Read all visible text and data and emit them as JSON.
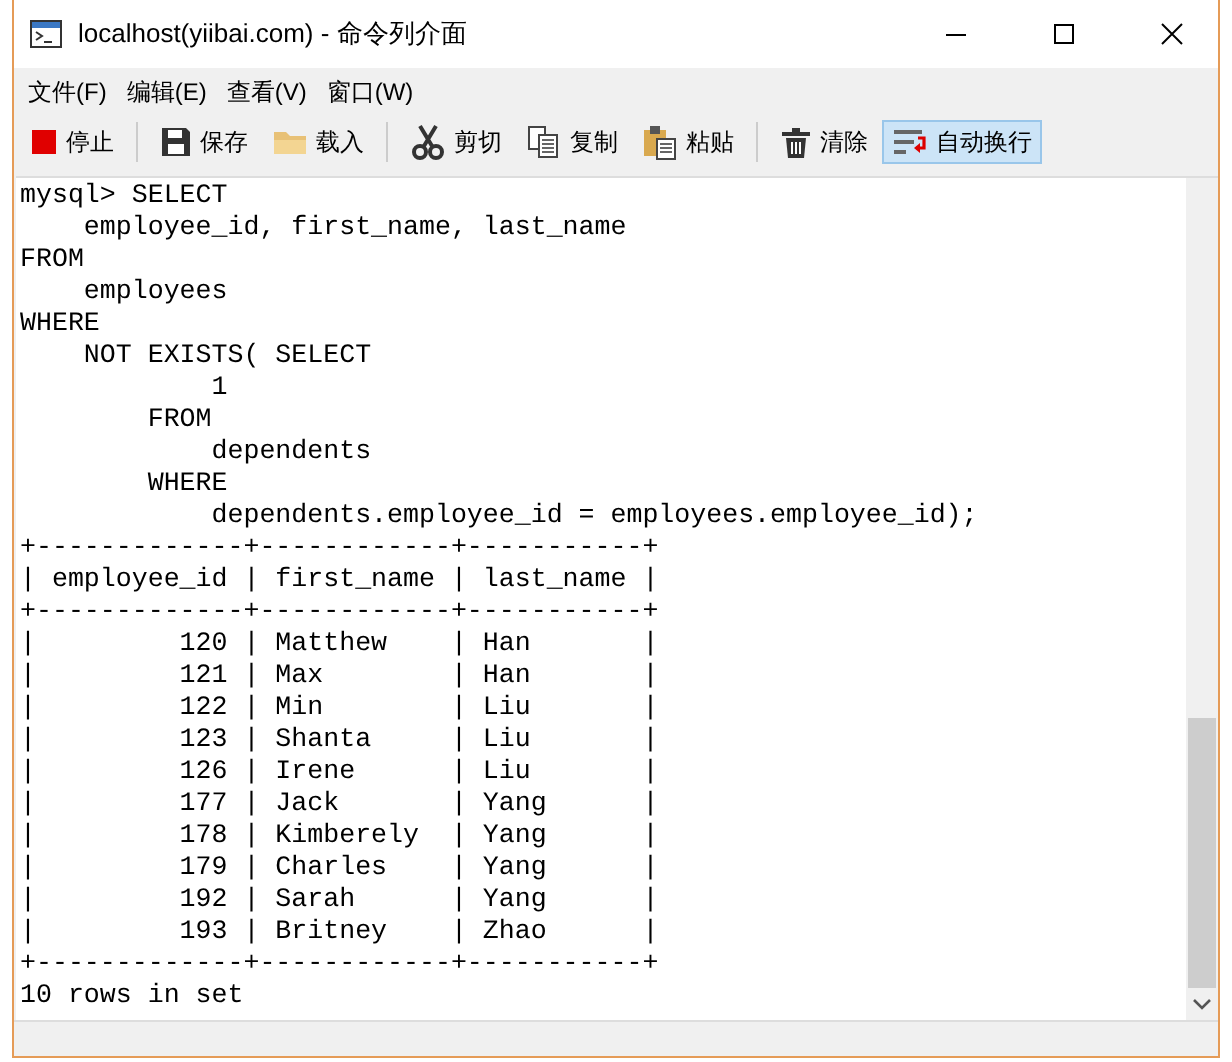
{
  "window": {
    "title": "localhost(yiibai.com) - 命令列介面"
  },
  "menu": [
    "文件(F)",
    "编辑(E)",
    "查看(V)",
    "窗口(W)"
  ],
  "toolbar": [
    {
      "kind": "stop",
      "label": "停止",
      "on": false
    },
    {
      "kind": "save",
      "label": "保存",
      "on": false
    },
    {
      "kind": "load",
      "label": "载入",
      "on": false
    },
    {
      "kind": "cut",
      "label": "剪切",
      "on": false
    },
    {
      "kind": "copy",
      "label": "复制",
      "on": false
    },
    {
      "kind": "paste",
      "label": "粘贴",
      "on": false
    },
    {
      "kind": "clear",
      "label": "清除",
      "on": false
    },
    {
      "kind": "wrap",
      "label": "自动换行",
      "on": true
    }
  ],
  "console": {
    "lines": [
      "mysql> SELECT",
      "    employee_id, first_name, last_name",
      "FROM",
      "    employees",
      "WHERE",
      "    NOT EXISTS( SELECT",
      "            1",
      "        FROM",
      "            dependents",
      "        WHERE",
      "            dependents.employee_id = employees.employee_id);",
      "+-------------+------------+-----------+",
      "| employee_id | first_name | last_name |",
      "+-------------+------------+-----------+",
      "|         120 | Matthew    | Han       |",
      "|         121 | Max        | Han       |",
      "|         122 | Min        | Liu       |",
      "|         123 | Shanta     | Liu       |",
      "|         126 | Irene      | Liu       |",
      "|         177 | Jack       | Yang      |",
      "|         178 | Kimberely  | Yang      |",
      "|         179 | Charles    | Yang      |",
      "|         192 | Sarah      | Yang      |",
      "|         193 | Britney    | Zhao      |",
      "+-------------+------------+-----------+",
      "10 rows in set"
    ]
  }
}
